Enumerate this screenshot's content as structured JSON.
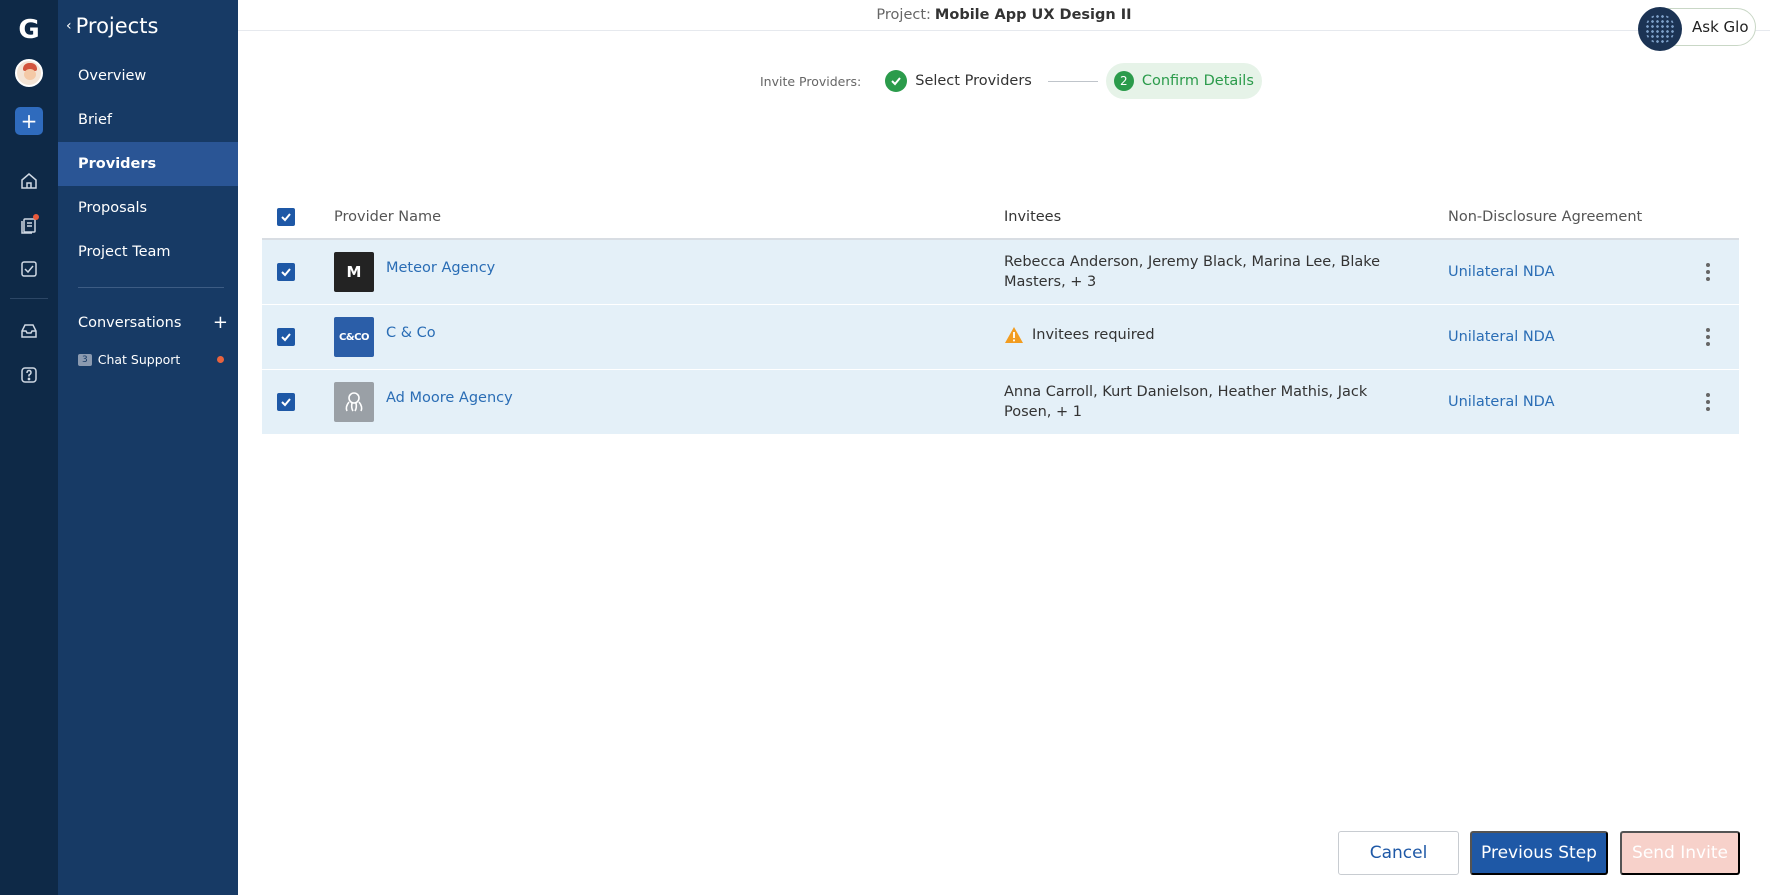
{
  "rail": {
    "logo": "G",
    "icons": [
      "logo-icon",
      "avatar",
      "plus-icon",
      "home-icon",
      "documents-icon",
      "tasks-icon",
      "inbox-icon",
      "help-icon"
    ]
  },
  "sidebar": {
    "back_label": "Projects",
    "items": [
      {
        "label": "Overview",
        "active": false
      },
      {
        "label": "Brief",
        "active": false
      },
      {
        "label": "Providers",
        "active": true
      },
      {
        "label": "Proposals",
        "active": false
      },
      {
        "label": "Project Team",
        "active": false
      }
    ],
    "conversations_label": "Conversations",
    "chat": {
      "count": "3",
      "label": "Chat Support"
    }
  },
  "header": {
    "project_label": "Project:",
    "project_name": "Mobile App UX Design II",
    "ask_glo": "Ask Glo"
  },
  "stepper": {
    "lead": "Invite Providers:",
    "step1": "Select Providers",
    "step2_num": "2",
    "step2": "Confirm Details"
  },
  "table": {
    "columns": [
      "Provider Name",
      "Invitees",
      "Non-Disclosure Agreement"
    ],
    "rows": [
      {
        "name": "Meteor Agency",
        "logo": "M",
        "invitees": "Rebecca Anderson, Jeremy Black, Marina Lee, Blake Masters, + 3",
        "nda": "Unilateral NDA",
        "warning": false
      },
      {
        "name": "C & Co",
        "logo": "C&CO",
        "invitees": "Invitees required",
        "nda": "Unilateral NDA",
        "warning": true
      },
      {
        "name": "Ad Moore Agency",
        "logo": "",
        "invitees": "Anna Carroll, Kurt Danielson, Heather Mathis, Jack Posen, + 1",
        "nda": "Unilateral NDA",
        "warning": false
      }
    ]
  },
  "footer": {
    "cancel": "Cancel",
    "previous": "Previous Step",
    "send": "Send Invite"
  },
  "colors": {
    "rail_bg": "#0e2947",
    "sidebar_bg": "#173a65",
    "sidebar_active": "#2a5595",
    "primary": "#1e58a6",
    "link": "#2a6db5",
    "success": "#2b9b4b",
    "row_bg": "#e4f0f8",
    "disabled_btn": "#f7d1ca"
  }
}
